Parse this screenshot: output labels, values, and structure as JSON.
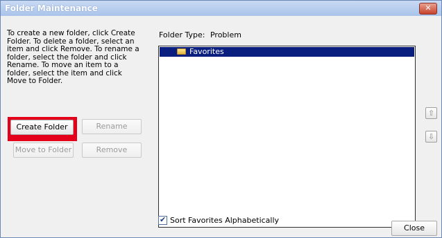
{
  "window": {
    "title": "Folder Maintenance",
    "close_glyph": "✕"
  },
  "instructions": "To create a new folder, click Create Folder. To delete a folder, select an item and click Remove. To rename a folder, select the folder and click Rename. To move an item to a folder, select the item and click Move to Folder.",
  "buttons": {
    "create_folder": "Create Folder",
    "rename": "Rename",
    "move_to_folder": "Move to Folder",
    "remove": "Remove",
    "close": "Close"
  },
  "folder_type": {
    "label": "Folder Type:",
    "value": "Problem"
  },
  "list": {
    "items": [
      {
        "label": "Favorites",
        "icon": "folder-icon",
        "selected": true
      }
    ]
  },
  "side_controls": {
    "up_icon": "up-arrow-icon",
    "down_icon": "down-arrow-icon",
    "up_glyph": "⇧",
    "down_glyph": "⇩"
  },
  "sort_checkbox": {
    "label": "Sort Favorites Alphabetically",
    "checked": true,
    "check_glyph": "✔"
  },
  "colors": {
    "highlight": "#e4001b",
    "selection": "#0a1e7f"
  }
}
